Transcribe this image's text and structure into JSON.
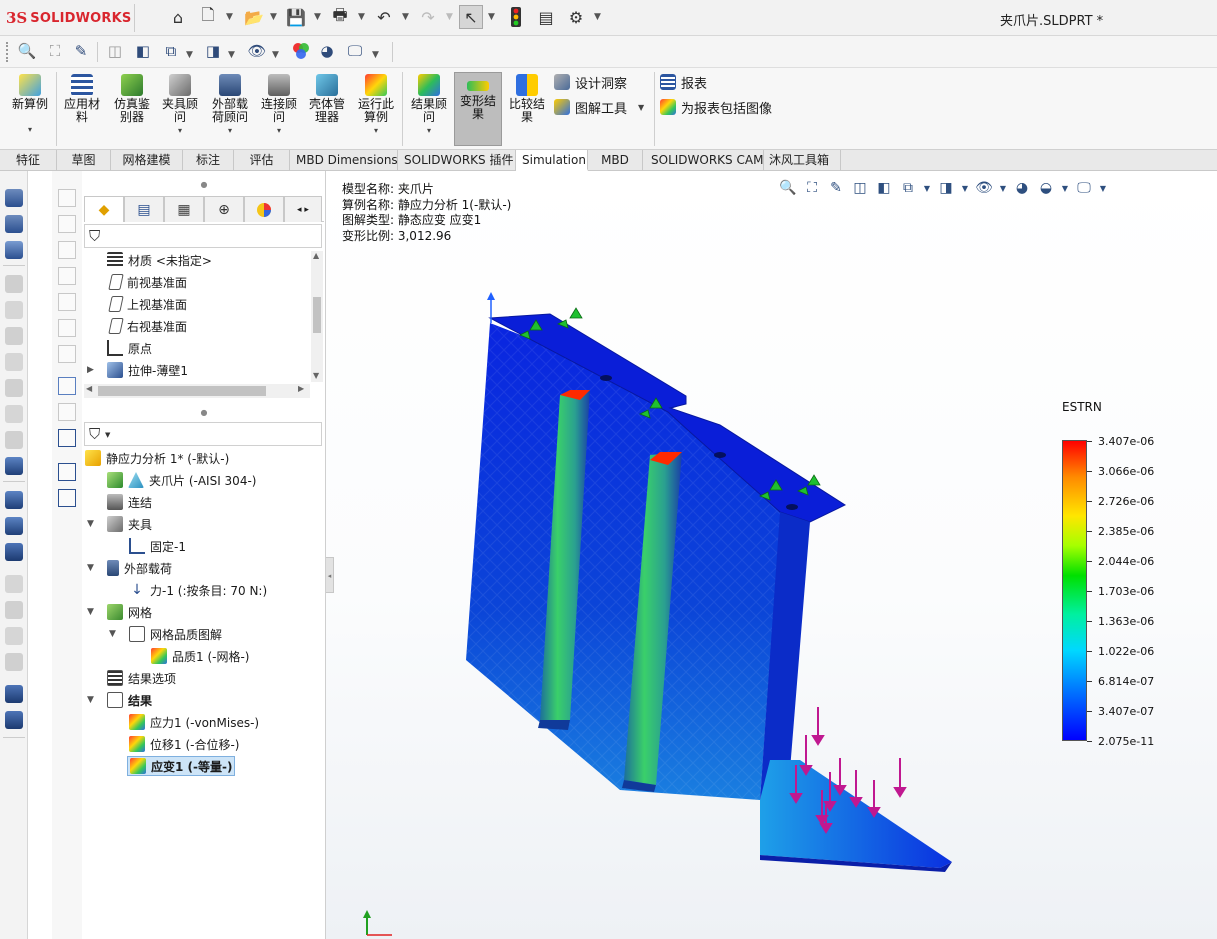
{
  "app": {
    "logo_ds": "3S",
    "logo_text": "SOLIDWORKS",
    "document_title": "夹爪片.SLDPRT *"
  },
  "ribbon": {
    "buttons": [
      {
        "label": "新算例"
      },
      {
        "label": "应用材料"
      },
      {
        "label": "仿真鉴别器"
      },
      {
        "label": "夹具顾问"
      },
      {
        "label": "外部载荷顾问"
      },
      {
        "label": "连接顾问"
      },
      {
        "label": "壳体管理器"
      },
      {
        "label": "运行此算例"
      },
      {
        "label": "结果顾问"
      },
      {
        "label": "变形结果"
      },
      {
        "label": "比较结果"
      }
    ],
    "small": [
      {
        "label": "设计洞察"
      },
      {
        "label": "图解工具"
      },
      {
        "label": "报表"
      },
      {
        "label": "为报表包括图像"
      }
    ]
  },
  "tabs": [
    "特征",
    "草图",
    "网格建模",
    "标注",
    "评估",
    "MBD Dimensions",
    "SOLIDWORKS 插件",
    "Simulation",
    "MBD",
    "SOLIDWORKS CAM",
    "沐风工具箱"
  ],
  "active_tab": "Simulation",
  "feature_tree": {
    "items": [
      {
        "label": "材质 <未指定>"
      },
      {
        "label": "前视基准面"
      },
      {
        "label": "上视基准面"
      },
      {
        "label": "右视基准面"
      },
      {
        "label": "原点"
      },
      {
        "label": "拉伸-薄壁1"
      }
    ]
  },
  "study_tree": {
    "study": "静应力分析 1* (-默认-)",
    "part": "夹爪片 (-AISI 304-)",
    "connections": "连结",
    "fixtures": "夹具",
    "fixture1": "固定-1",
    "loads": "外部载荷",
    "force1": "力-1 (:按条目: 70 N:)",
    "mesh": "网格",
    "mesh_quality": "网格品质图解",
    "quality1": "品质1 (-网格-)",
    "result_options": "结果选项",
    "results": "结果",
    "stress1": "应力1 (-vonMises-)",
    "disp1": "位移1 (-合位移-)",
    "strain1": "应变1 (-等量-)"
  },
  "viewport": {
    "info": [
      "模型名称: 夹爪片",
      "算例名称: 静应力分析 1(-默认-)",
      "图解类型: 静态应变 应变1",
      "变形比例: 3,012.96"
    ],
    "legend": {
      "title": "ESTRN",
      "labels": [
        "3.407e-06",
        "3.066e-06",
        "2.726e-06",
        "2.385e-06",
        "2.044e-06",
        "1.703e-06",
        "1.363e-06",
        "1.022e-06",
        "6.814e-07",
        "3.407e-07",
        "2.075e-11"
      ],
      "colors": [
        "#ff0000",
        "#ffe600",
        "#00e000",
        "#00d8ff",
        "#0000ff"
      ]
    }
  }
}
